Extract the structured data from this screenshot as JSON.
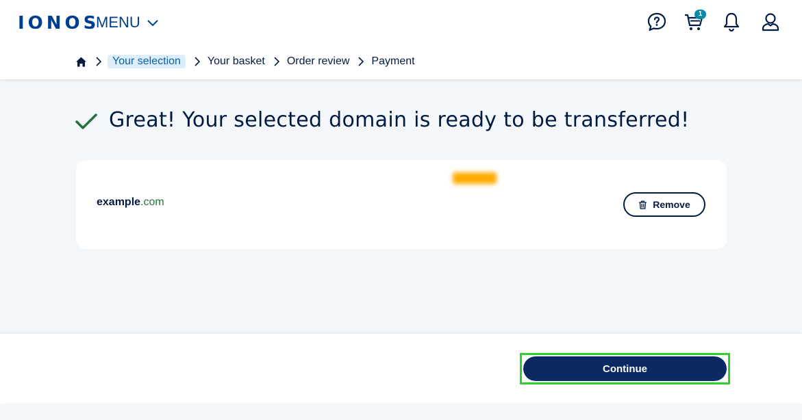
{
  "header": {
    "logo": "IONOS",
    "menu_label": "MENU",
    "cart_count": "1",
    "icons": [
      "help-chat-icon",
      "cart-icon",
      "bell-icon",
      "user-icon"
    ]
  },
  "breadcrumb": {
    "items": [
      "Your selection",
      "Your basket",
      "Order review",
      "Payment"
    ],
    "active_index": 0
  },
  "main": {
    "title": "Great! Your selected domain is ready to be transferred!"
  },
  "domain_card": {
    "domain_name": "example",
    "domain_tld": ".com",
    "remove_label": "Remove"
  },
  "footer": {
    "continue_label": "Continue"
  },
  "colors": {
    "brand": "#003d8f",
    "dark_navy": "#0b2a63",
    "success_green": "#23743b",
    "highlight_green": "#2ccf2c",
    "badge_teal": "#0b8aa8"
  }
}
